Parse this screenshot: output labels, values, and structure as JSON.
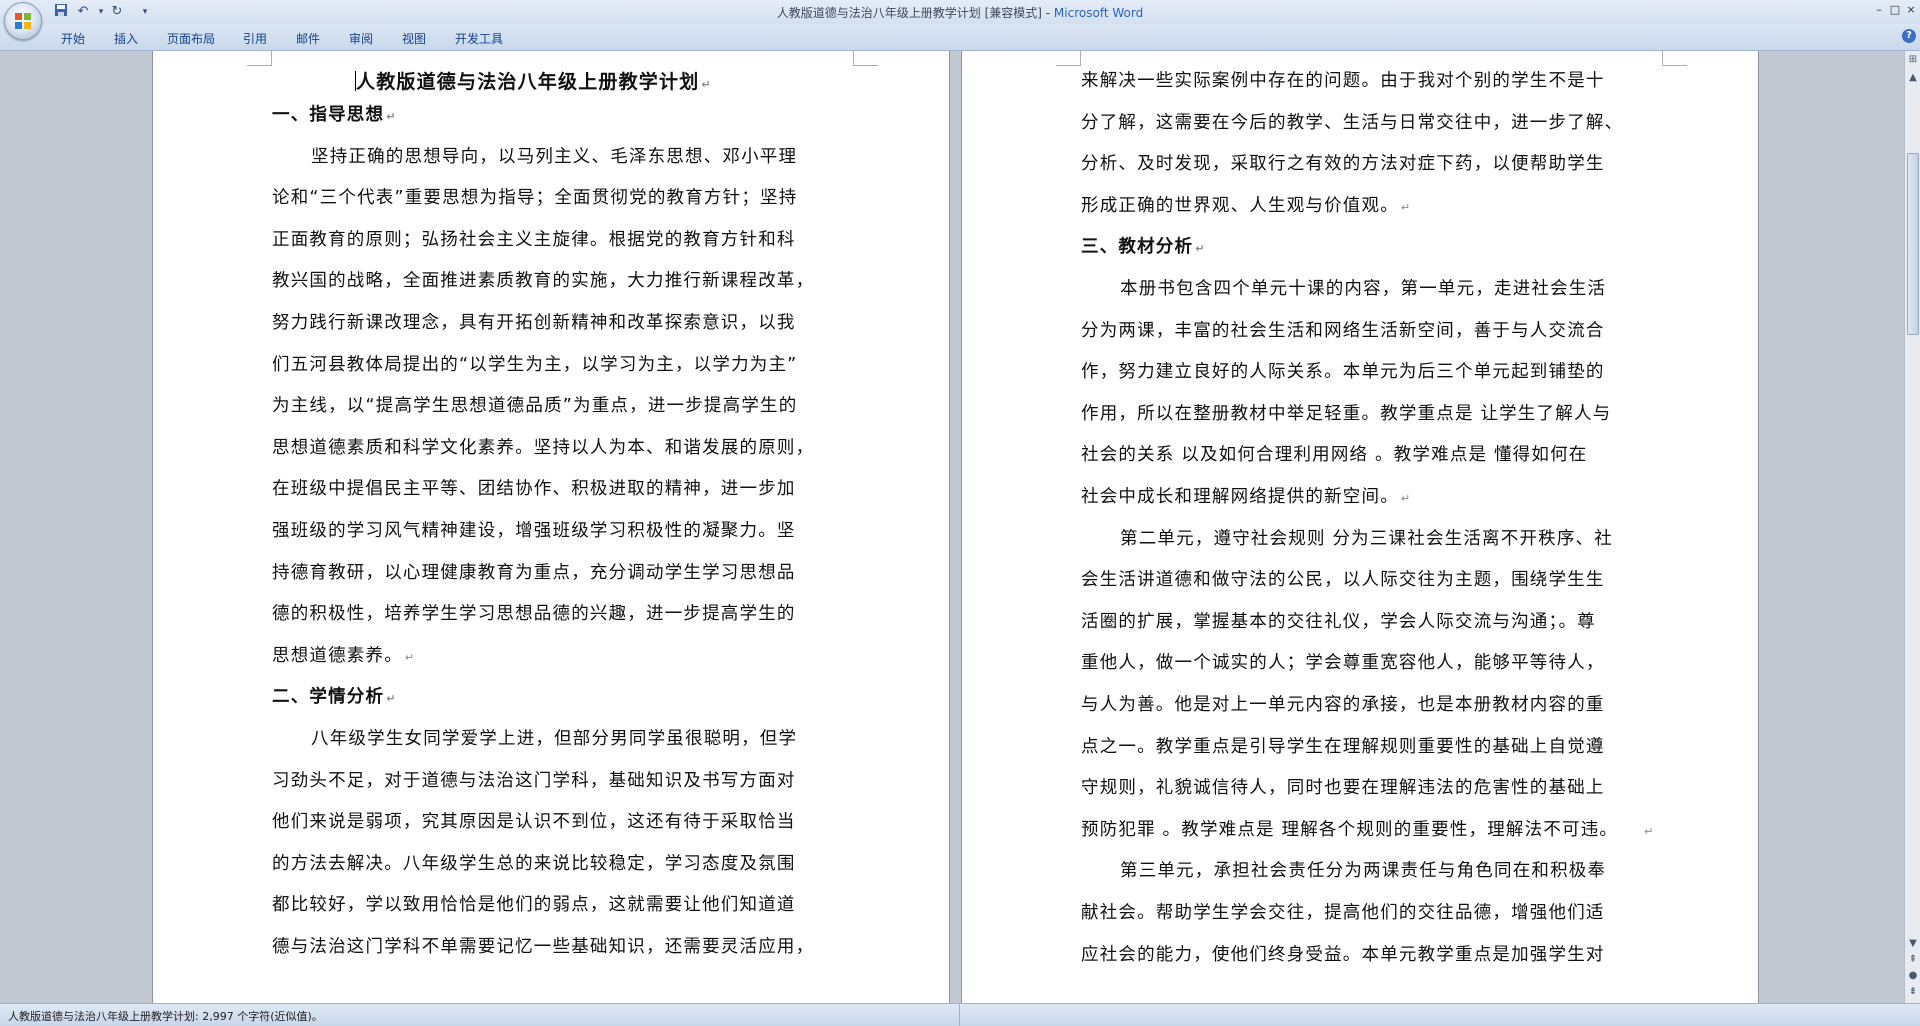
{
  "window": {
    "title_doc": "人教版道德与法治八年级上册教学计划 [兼容模式] - ",
    "title_app": "Microsoft Word",
    "controls": [
      "–",
      "□",
      "×"
    ]
  },
  "ribbon": {
    "tabs": [
      "开始",
      "插入",
      "页面布局",
      "引用",
      "邮件",
      "审阅",
      "视图",
      "开发工具"
    ],
    "help": "?"
  },
  "left_page": {
    "title": "人教版道德与法治八年级上册教学计划",
    "lines": [
      {
        "text": "一、指导思想",
        "kind": "heading"
      },
      {
        "text": "坚持正确的思想导向，以马列主义、毛泽东思想、邓小平理",
        "kind": "indent"
      },
      {
        "text": "论和“三个代表”重要思想为指导；全面贯彻党的教育方针；坚持",
        "kind": "body"
      },
      {
        "text": "正面教育的原则；弘扬社会主义主旋律。根据党的教育方针和科",
        "kind": "body"
      },
      {
        "text": "教兴国的战略，全面推进素质教育的实施，大力推行新课程改革，",
        "kind": "body"
      },
      {
        "text": "努力践行新课改理念，具有开拓创新精神和改革探索意识，以我",
        "kind": "body"
      },
      {
        "text": "们五河县教体局提出的“以学生为主，以学习为主，以学力为主”",
        "kind": "body"
      },
      {
        "text": "为主线，以“提高学生思想道德品质”为重点，进一步提高学生的",
        "kind": "body"
      },
      {
        "text": "思想道德素质和科学文化素养。坚持以人为本、和谐发展的原则，",
        "kind": "body"
      },
      {
        "text": "在班级中提倡民主平等、团结协作、积极进取的精神，进一步加",
        "kind": "body"
      },
      {
        "text": "强班级的学习风气精神建设，增强班级学习积极性的凝聚力。坚",
        "kind": "body"
      },
      {
        "text": "持德育教研，以心理健康教育为重点，充分调动学生学习思想品",
        "kind": "body"
      },
      {
        "text": "德的积极性，培养学生学习思想品德的兴趣，进一步提高学生的",
        "kind": "body"
      },
      {
        "text": "思想道德素养。",
        "kind": "body_end"
      },
      {
        "text": "二、学情分析",
        "kind": "heading"
      },
      {
        "text": "八年级学生女同学爱学上进，但部分男同学虽很聪明，但学",
        "kind": "indent"
      },
      {
        "text": "习劲头不足，对于道德与法治这门学科，基础知识及书写方面对",
        "kind": "body"
      },
      {
        "text": "他们来说是弱项，究其原因是认识不到位，这还有待于采取恰当",
        "kind": "body"
      },
      {
        "text": "的方法去解决。八年级学生总的来说比较稳定，学习态度及氛围",
        "kind": "body"
      },
      {
        "text": "都比较好，学以致用恰恰是他们的弱点，这就需要让他们知道道",
        "kind": "body"
      },
      {
        "text": "德与法治这门学科不单需要记忆一些基础知识，还需要灵活应用，",
        "kind": "body"
      }
    ]
  },
  "right_page": {
    "lines": [
      {
        "text": "来解决一些实际案例中存在的问题。由于我对个别的学生不是十",
        "kind": "body"
      },
      {
        "text": "分了解，这需要在今后的教学、生活与日常交往中，进一步了解、",
        "kind": "body"
      },
      {
        "text": "分析、及时发现，采取行之有效的方法对症下药，以便帮助学生",
        "kind": "body"
      },
      {
        "text": "形成正确的世界观、人生观与价值观。",
        "kind": "body_end"
      },
      {
        "text": "三、教材分析",
        "kind": "heading"
      },
      {
        "text": "本册书包含四个单元十课的内容，第一单元，走进社会生活",
        "kind": "indent"
      },
      {
        "text": "分为两课，丰富的社会生活和网络生活新空间，善于与人交流合",
        "kind": "body"
      },
      {
        "text": "作，努力建立良好的人际关系。本单元为后三个单元起到铺垫的",
        "kind": "body"
      },
      {
        "text": "作用，所以在整册教材中举足轻重。教学重点是  让学生了解人与",
        "kind": "body"
      },
      {
        "text": "社会的关系  以及如何合理利用网络  。教学难点是  懂得如何在",
        "kind": "body"
      },
      {
        "text": "社会中成长和理解网络提供的新空间。",
        "kind": "body_end"
      },
      {
        "text": "第二单元，遵守社会规则  分为三课社会生活离不开秩序、社",
        "kind": "indent"
      },
      {
        "text": "会生活讲道德和做守法的公民，以人际交往为主题，围绕学生生",
        "kind": "body"
      },
      {
        "text": "活圈的扩展，掌握基本的交往礼仪，学会人际交流与沟通；。尊",
        "kind": "body"
      },
      {
        "text": "重他人，做一个诚实的人；学会尊重宽容他人，能够平等待人，",
        "kind": "body"
      },
      {
        "text": "与人为善。他是对上一单元内容的承接，也是本册教材内容的重",
        "kind": "body"
      },
      {
        "text": "点之一。教学重点是引导学生在理解规则重要性的基础上自觉遵",
        "kind": "body"
      },
      {
        "text": "守规则，礼貌诚信待人，同时也要在理解违法的危害性的基础上",
        "kind": "body"
      },
      {
        "text": "预防犯罪  。教学难点是  理解各个规则的重要性，理解法不可违。",
        "kind": "body_end_far"
      },
      {
        "text": "第三单元，承担社会责任分为两课责任与角色同在和积极奉",
        "kind": "indent"
      },
      {
        "text": "献社会。帮助学生学会交往，提高他们的交往品德，增强他们适",
        "kind": "body"
      },
      {
        "text": "应社会的能力，使他们终身受益。本单元教学重点是加强学生对",
        "kind": "body"
      }
    ]
  },
  "paragraph_mark": "↵",
  "status": {
    "text": "人教版道德与法治八年级上册教学计划: 2,997 个字符(近似值)。"
  }
}
